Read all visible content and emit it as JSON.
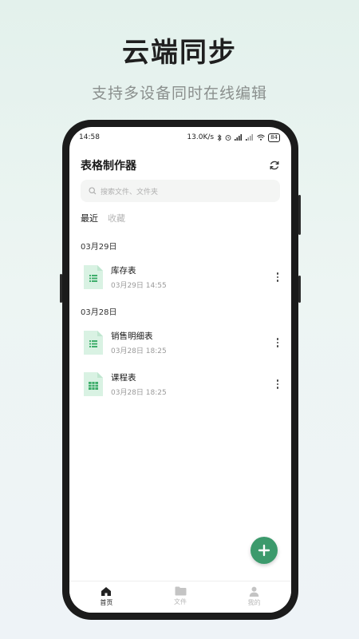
{
  "promo": {
    "title": "云端同步",
    "subtitle": "支持多设备同时在线编辑"
  },
  "status_bar": {
    "time": "14:58",
    "network_speed": "13.0K/s",
    "battery": "84"
  },
  "app_bar": {
    "title": "表格制作器",
    "refresh_icon": "refresh-icon"
  },
  "search": {
    "placeholder": "搜索文件、文件夹"
  },
  "tabs": [
    {
      "label": "最近",
      "active": true
    },
    {
      "label": "收藏",
      "active": false
    }
  ],
  "groups": [
    {
      "date": "03月29日",
      "files": [
        {
          "name": "库存表",
          "modified": "03月29日 14:55",
          "icon": "spreadsheet-list-icon"
        }
      ]
    },
    {
      "date": "03月28日",
      "files": [
        {
          "name": "销售明细表",
          "modified": "03月28日 18:25",
          "icon": "spreadsheet-list-icon"
        },
        {
          "name": "课程表",
          "modified": "03月28日 18:25",
          "icon": "spreadsheet-grid-icon"
        }
      ]
    }
  ],
  "fab": {
    "icon": "plus-icon"
  },
  "bottom_nav": [
    {
      "label": "首页",
      "icon": "home-icon",
      "active": true
    },
    {
      "label": "文件",
      "icon": "folder-icon",
      "active": false
    },
    {
      "label": "我的",
      "icon": "person-icon",
      "active": false
    }
  ],
  "colors": {
    "accent": "#3c9a6c",
    "file_icon_bg": "#d9f2e3",
    "file_icon_mark": "#3fae6c"
  }
}
